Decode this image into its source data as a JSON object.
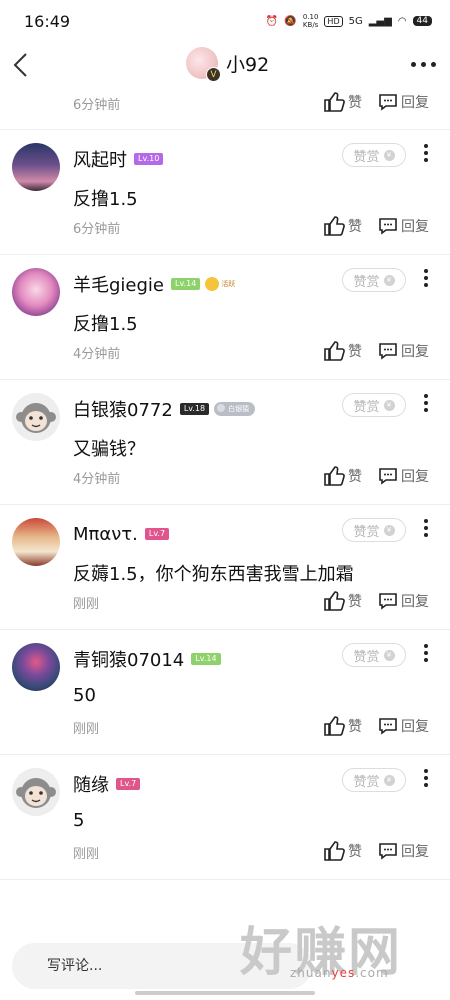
{
  "status_bar": {
    "time": "16:49",
    "net_speed_value": "0.10",
    "net_speed_unit": "KB/s",
    "hd": "HD",
    "signal": "5G",
    "battery": "44"
  },
  "header": {
    "title": "小92",
    "avatar_badge": "V"
  },
  "partial_row": {
    "time": "6分钟前",
    "like_label": "赞",
    "reply_label": "回复"
  },
  "comments": [
    {
      "name": "风起时",
      "level": "Lv.10",
      "level_color": "#b469e8",
      "text": "反撸1.5",
      "time": "6分钟前",
      "reward_label": "赞赏",
      "like_label": "赞",
      "reply_label": "回复"
    },
    {
      "name": "羊毛giegie",
      "level": "Lv.14",
      "level_color": "#8fd16a",
      "extra_tag": "活跃",
      "text": "反撸1.5",
      "time": "4分钟前",
      "reward_label": "赞赏",
      "like_label": "赞",
      "reply_label": "回复"
    },
    {
      "name": "白银猿0772",
      "level": "Lv.18",
      "level_color": "#2a2a2a",
      "extra_tag": "白银猿",
      "text": "又骗钱？",
      "time": "4分钟前",
      "reward_label": "赞赏",
      "like_label": "赞",
      "reply_label": "回复"
    },
    {
      "name": "Μπαντ.",
      "level": "Lv.7",
      "level_color": "#e0558c",
      "text": "反薅1.5，你个狗东西害我雪上加霜",
      "time": "刚刚",
      "reward_label": "赞赏",
      "like_label": "赞",
      "reply_label": "回复"
    },
    {
      "name": "青铜猿07014",
      "level": "Lv.14",
      "level_color": "#8fd16a",
      "text": "50",
      "time": "刚刚",
      "reward_label": "赞赏",
      "like_label": "赞",
      "reply_label": "回复"
    },
    {
      "name": "随缘",
      "level": "Lv.7",
      "level_color": "#e0558c",
      "text": "5",
      "time": "刚刚",
      "reward_label": "赞赏",
      "like_label": "赞",
      "reply_label": "回复"
    }
  ],
  "bottom": {
    "input_placeholder": "写评论...",
    "watermark": "好赚网",
    "watermark_url_pre": "zhuan",
    "watermark_url_mid": "yes",
    "watermark_url_post": ".com"
  }
}
